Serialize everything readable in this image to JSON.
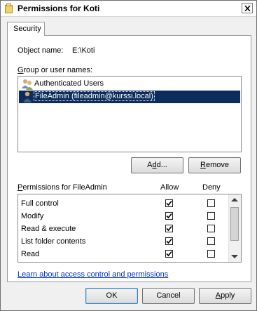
{
  "window": {
    "title": "Permissions for Koti"
  },
  "tabs": [
    {
      "label": "Security"
    }
  ],
  "object": {
    "label": "Object name:",
    "value": "E:\\Koti"
  },
  "groups": {
    "label_prefix": "G",
    "label_rest": "roup or user names:",
    "items": [
      {
        "name": "Authenticated Users",
        "icon": "users-group-icon",
        "selected": false
      },
      {
        "name": "FileAdmin (fileadmin@kurssi.local)",
        "icon": "user-icon",
        "selected": true
      }
    ]
  },
  "buttons": {
    "add_prefix": "A",
    "add_accel": "d",
    "add_rest": "d...",
    "remove_accel": "R",
    "remove_rest": "emove",
    "ok": "OK",
    "cancel": "Cancel",
    "apply_accel": "A",
    "apply_rest": "pply"
  },
  "permissions": {
    "label_accel": "P",
    "label_rest": "ermissions for FileAdmin",
    "allow_header": "Allow",
    "deny_header": "Deny",
    "rows": [
      {
        "name": "Full control",
        "allow": true,
        "deny": false
      },
      {
        "name": "Modify",
        "allow": true,
        "deny": false
      },
      {
        "name": "Read & execute",
        "allow": true,
        "deny": false
      },
      {
        "name": "List folder contents",
        "allow": true,
        "deny": false
      },
      {
        "name": "Read",
        "allow": true,
        "deny": false
      }
    ]
  },
  "link": "Learn about access control and permissions",
  "colors": {
    "selection": "#0c2c5c",
    "link": "#0033cc"
  }
}
